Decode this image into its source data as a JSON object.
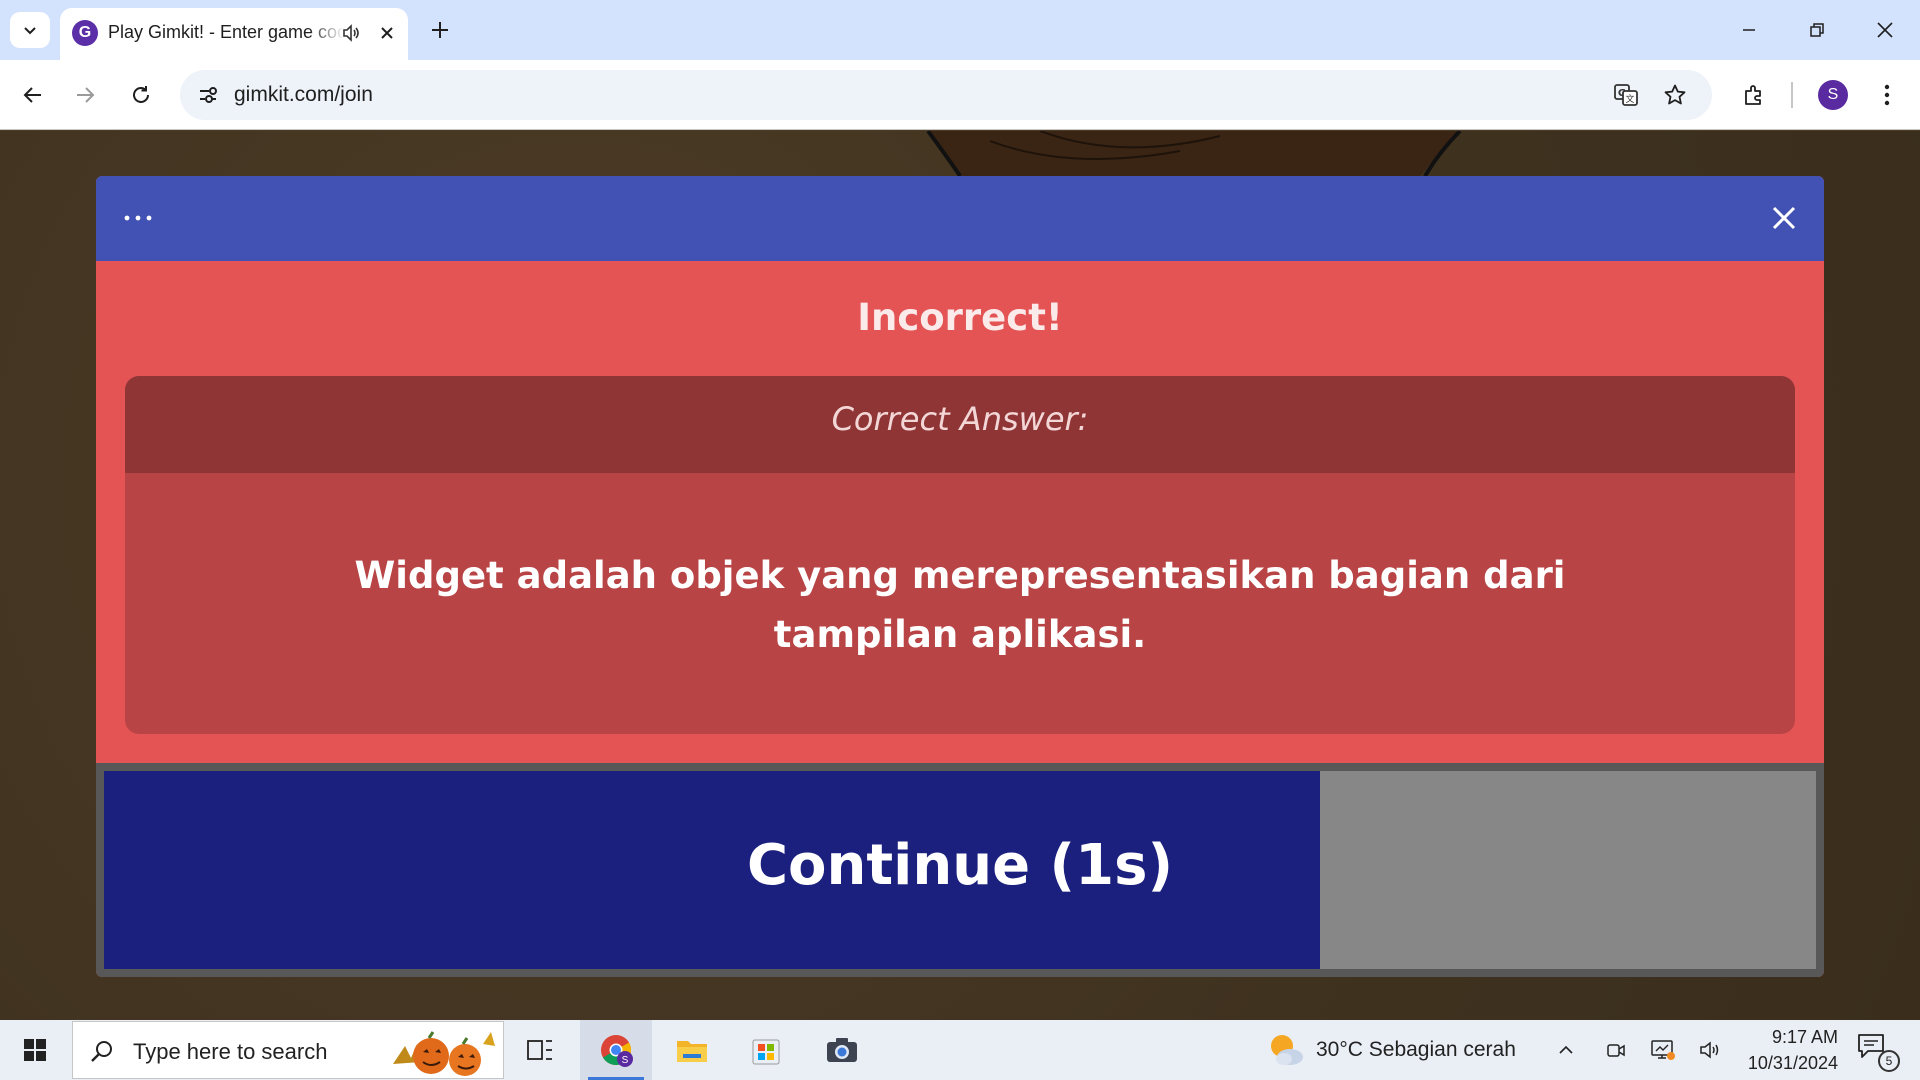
{
  "browser": {
    "tab": {
      "title": "Play Gimkit! - Enter game code",
      "favicon_letter": "G"
    },
    "url": "gimkit.com/join",
    "profile_initial": "S"
  },
  "modal": {
    "result_title": "Incorrect!",
    "correct_answer_label": "Correct Answer:",
    "correct_answer_text": "Widget adalah objek yang merepresentasikan bagian dari tampilan aplikasi.",
    "continue_label": "Continue (1s)",
    "continue_timer_progress": 0.71,
    "colors": {
      "header": "#4252b4",
      "incorrect": "#e45455",
      "continue_fill": "#1b207e"
    }
  },
  "taskbar": {
    "search_placeholder": "Type here to search",
    "weather": "30°C  Sebagian cerah",
    "time": "9:17 AM",
    "date": "10/31/2024",
    "notification_count": "5"
  }
}
